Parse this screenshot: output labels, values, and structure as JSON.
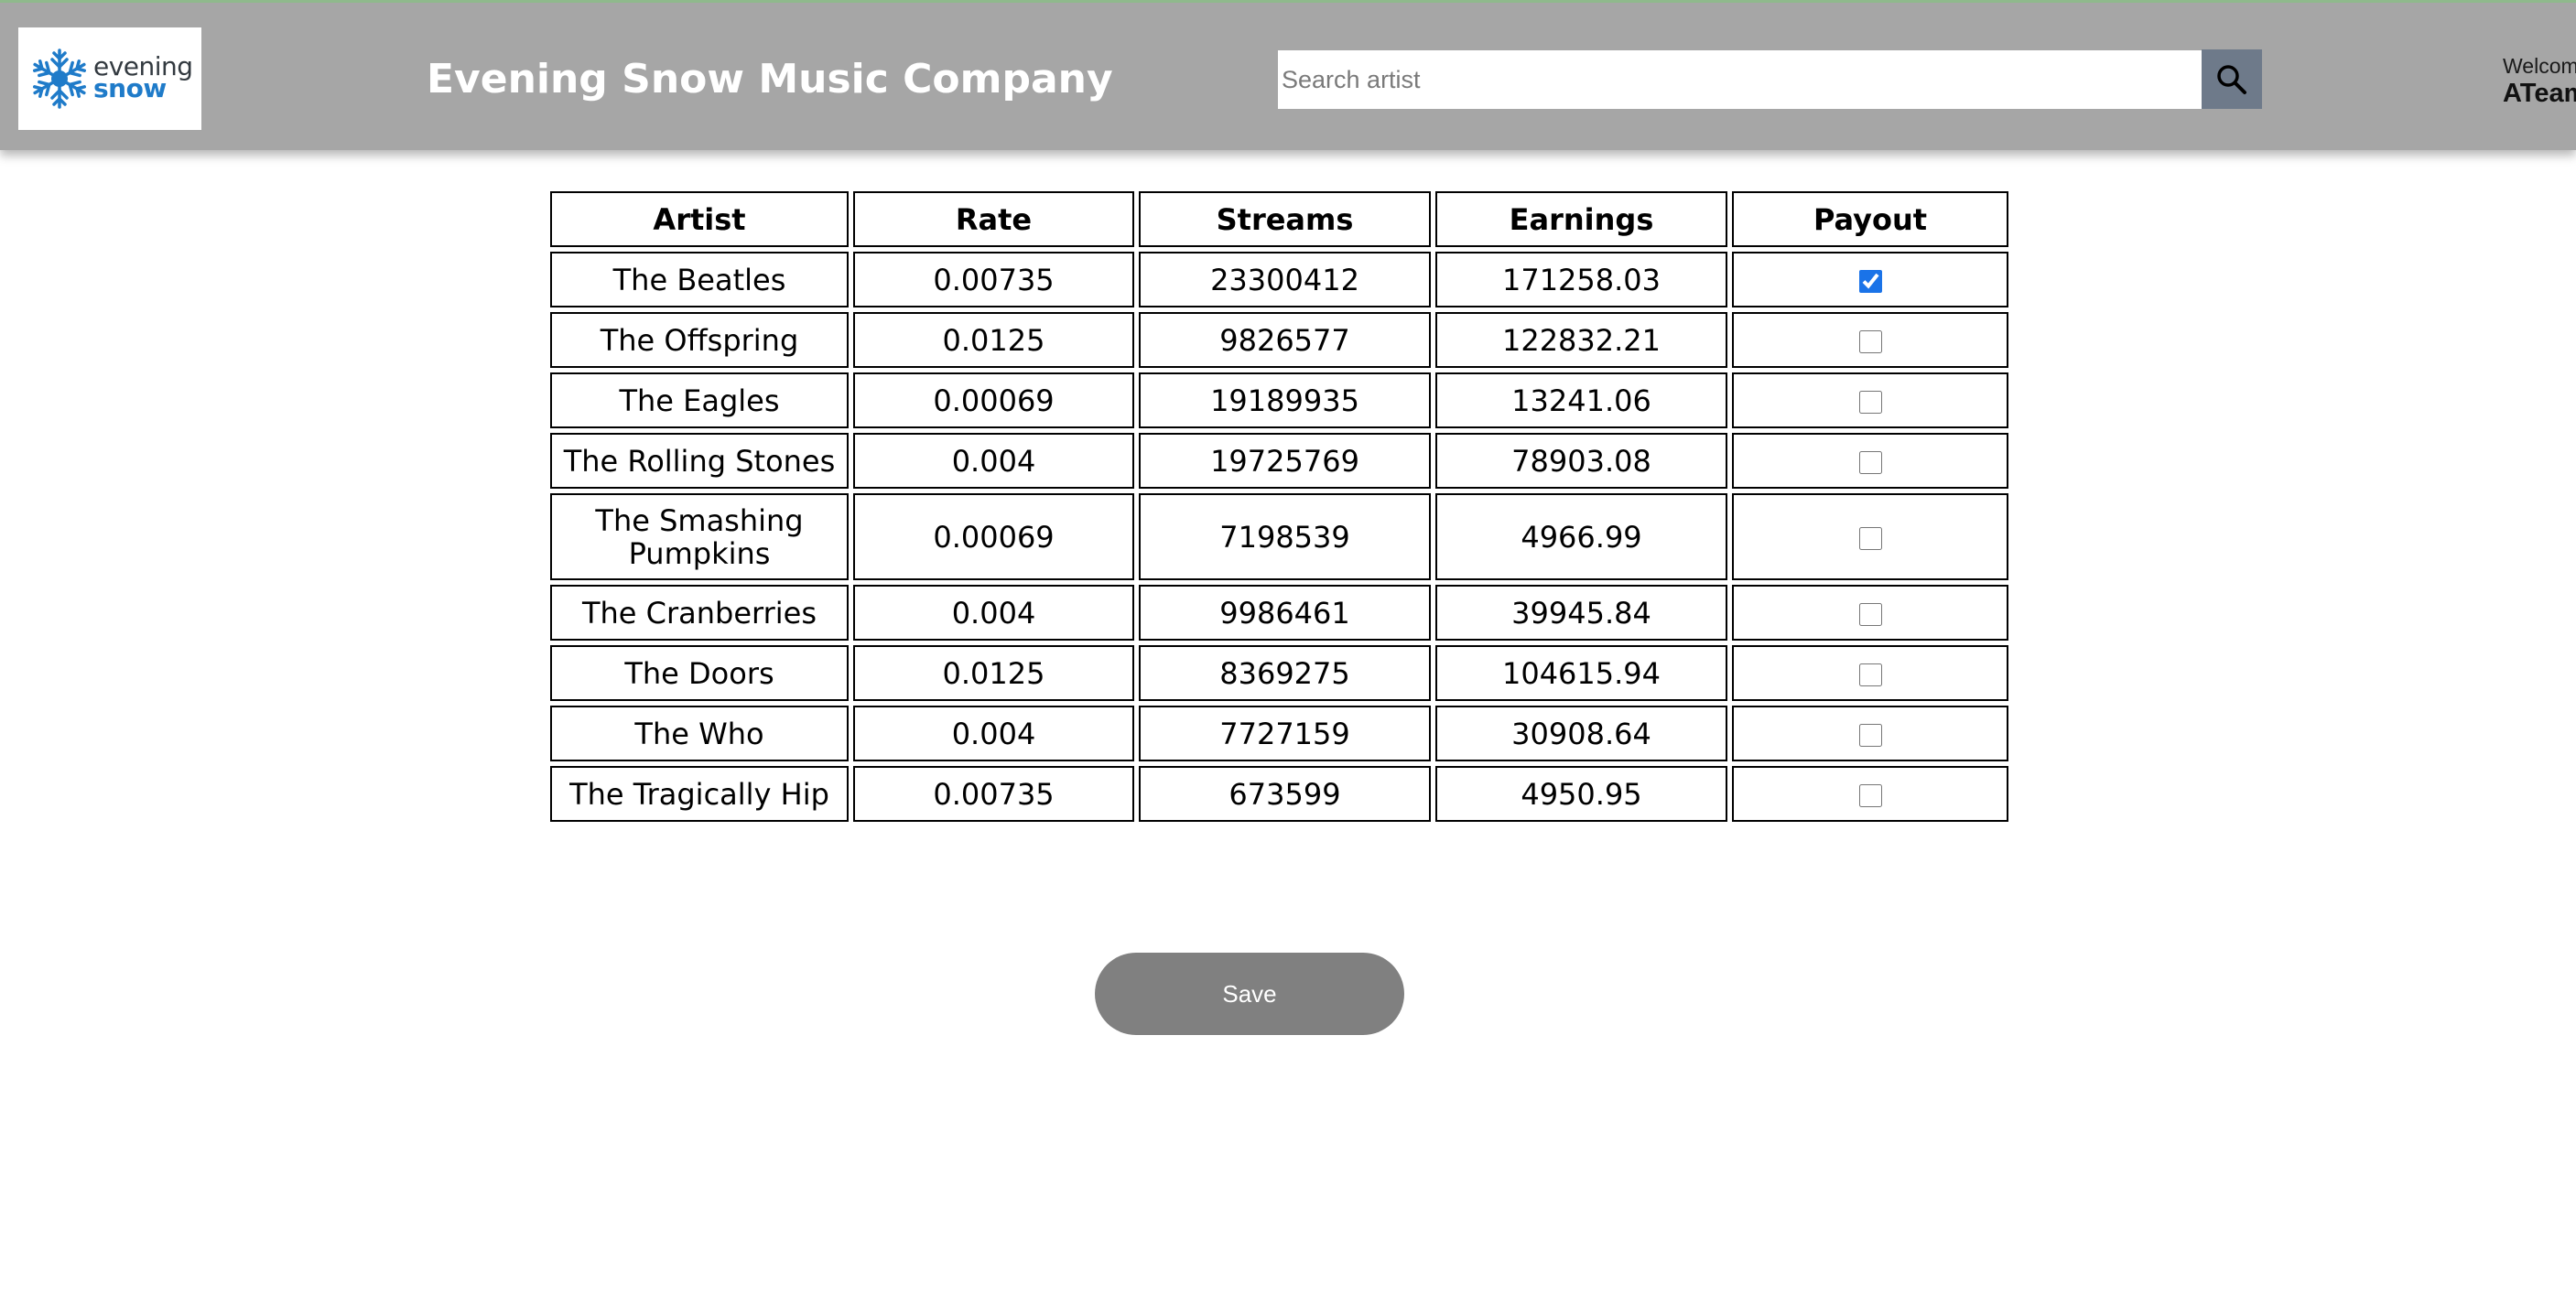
{
  "header": {
    "logo": {
      "word1": "evening",
      "word2": "snow"
    },
    "title": "Evening Snow Music Company",
    "search": {
      "placeholder": "Search artist",
      "value": ""
    },
    "welcome_text": "Welcome",
    "username": "ATeam"
  },
  "colors": {
    "header_bg": "#a6a6a6",
    "search_button_bg": "#6e7a8a",
    "logo_blue": "#1f7bc9",
    "save_button_bg": "#808080",
    "checkbox_accent": "#1a73e8"
  },
  "table": {
    "columns": [
      "Artist",
      "Rate",
      "Streams",
      "Earnings",
      "Payout"
    ],
    "rows": [
      {
        "artist": "The Beatles",
        "rate": "0.00735",
        "streams": "23300412",
        "earnings": "171258.03",
        "payout": true
      },
      {
        "artist": "The Offspring",
        "rate": "0.0125",
        "streams": "9826577",
        "earnings": "122832.21",
        "payout": false
      },
      {
        "artist": "The Eagles",
        "rate": "0.00069",
        "streams": "19189935",
        "earnings": "13241.06",
        "payout": false
      },
      {
        "artist": "The Rolling Stones",
        "rate": "0.004",
        "streams": "19725769",
        "earnings": "78903.08",
        "payout": false
      },
      {
        "artist": "The Smashing Pumpkins",
        "rate": "0.00069",
        "streams": "7198539",
        "earnings": "4966.99",
        "payout": false
      },
      {
        "artist": "The Cranberries",
        "rate": "0.004",
        "streams": "9986461",
        "earnings": "39945.84",
        "payout": false
      },
      {
        "artist": "The Doors",
        "rate": "0.0125",
        "streams": "8369275",
        "earnings": "104615.94",
        "payout": false
      },
      {
        "artist": "The Who",
        "rate": "0.004",
        "streams": "7727159",
        "earnings": "30908.64",
        "payout": false
      },
      {
        "artist": "The Tragically Hip",
        "rate": "0.00735",
        "streams": "673599",
        "earnings": "4950.95",
        "payout": false
      }
    ]
  },
  "actions": {
    "save_label": "Save"
  },
  "icons": {
    "logo": "snowflake-icon",
    "search": "search-icon"
  }
}
